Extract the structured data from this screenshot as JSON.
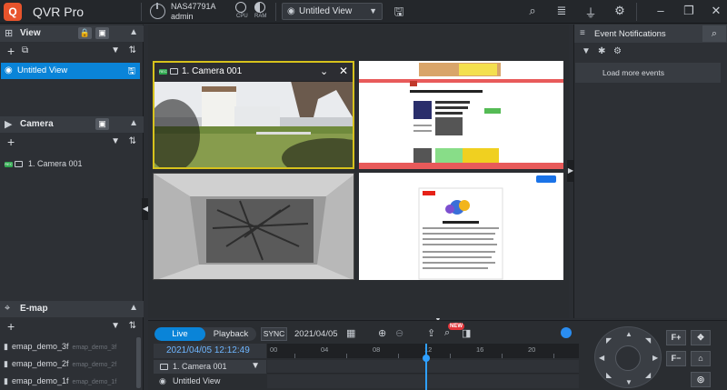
{
  "app": {
    "title": "QVR Pro",
    "logo_glyph": "Q"
  },
  "topbar": {
    "nas_name": "NAS47791A",
    "nas_user": "admin",
    "cpu_label": "CPU",
    "ram_label": "RAM",
    "view_select_value": "Untitled View",
    "icons": [
      "power-icon",
      "search-icon",
      "stack-icon",
      "bell-icon",
      "settings-icon",
      "minimize-icon",
      "maximize-icon",
      "close-icon"
    ]
  },
  "left": {
    "view_section_title": "View",
    "view_items": [
      {
        "label": "Untitled View"
      }
    ],
    "camera_section_title": "Camera",
    "camera_items": [
      {
        "label": "1. Camera 001",
        "badge": "REC"
      }
    ],
    "emap_section_title": "E-map",
    "emap_items": [
      {
        "label": "emap_demo_3f",
        "sub": "emap_demo_3f"
      },
      {
        "label": "emap_demo_2f",
        "sub": "emap_demo_2f"
      },
      {
        "label": "emap_demo_1f",
        "sub": "emap_demo_1f"
      }
    ]
  },
  "center": {
    "tile1_title": "1. Camera 001",
    "tile1_badge": "REC"
  },
  "right": {
    "title": "Event Notifications",
    "load_more": "Load more events"
  },
  "bottom": {
    "live_label": "Live",
    "playback_label": "Playback",
    "sync_label": "SYNC",
    "date": "2021/04/05",
    "new_badge": "NEW",
    "datetime": "2021/04/05 12:12:49",
    "ruler_ticks": [
      "00",
      "04",
      "08",
      "12",
      "16",
      "20"
    ],
    "timeline_rows": [
      {
        "label": "1. Camera 001"
      },
      {
        "label": "Untitled View"
      }
    ],
    "ptz_buttons": [
      "F+",
      "F−"
    ]
  },
  "colors": {
    "accent": "#0a84d8",
    "selection": "#d7c21c",
    "rec": "#2fa84f",
    "badge": "#e3353a"
  }
}
